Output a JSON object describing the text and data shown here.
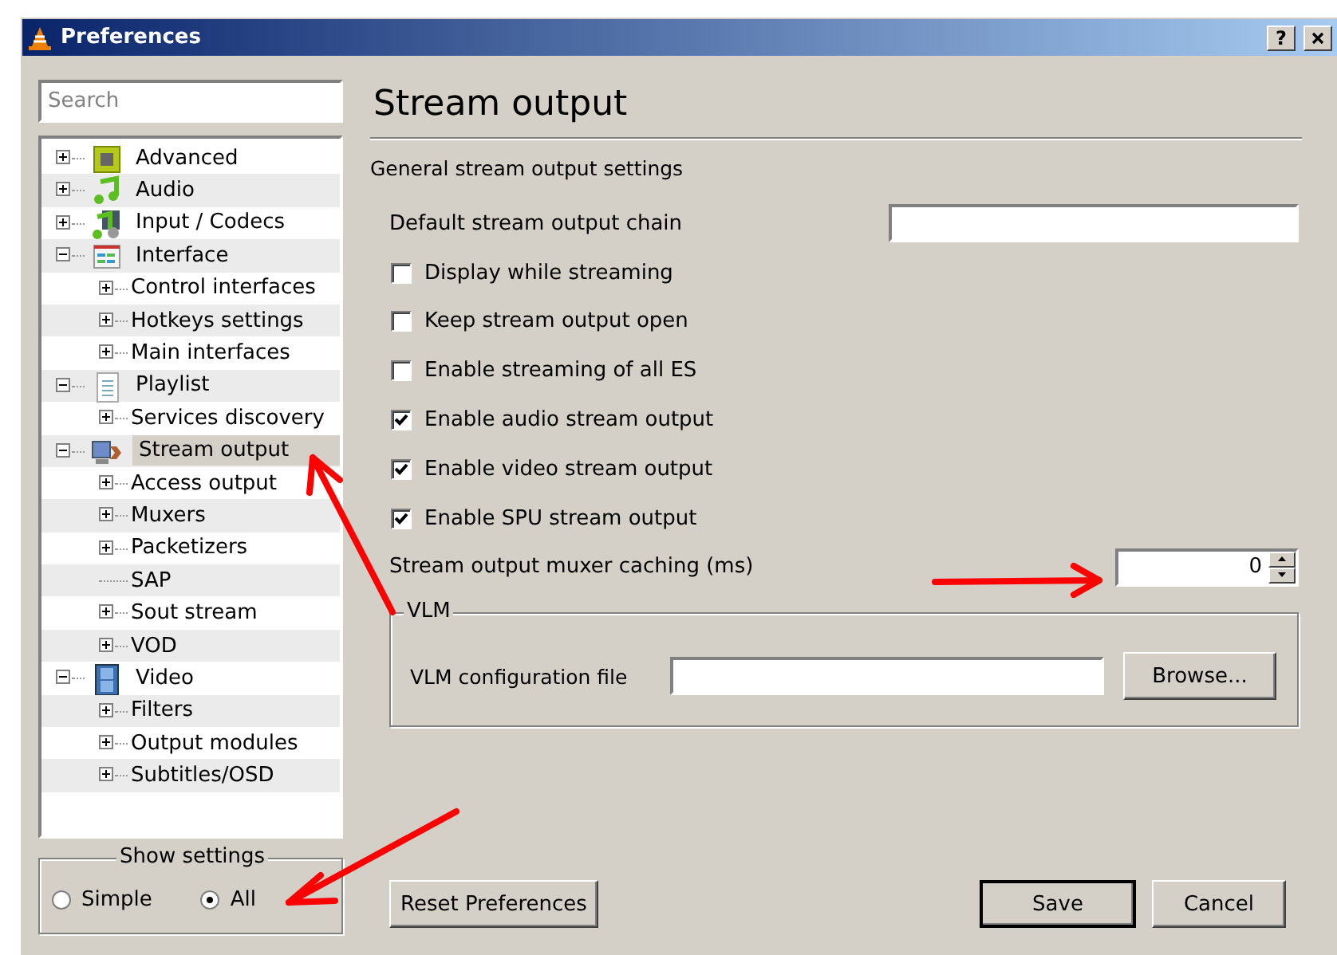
{
  "window": {
    "title": "Preferences",
    "help": "?"
  },
  "search": {
    "placeholder": "Search"
  },
  "tree": [
    {
      "label": "Advanced",
      "kind": "branch",
      "expanded": false,
      "selected": false
    },
    {
      "label": "Audio",
      "kind": "branch",
      "expanded": false,
      "selected": false
    },
    {
      "label": "Input / Codecs",
      "kind": "branch",
      "expanded": false,
      "selected": false
    },
    {
      "label": "Interface",
      "kind": "branch",
      "expanded": true,
      "selected": false,
      "children": [
        {
          "label": "Control interfaces",
          "kind": "branch",
          "expanded": false,
          "selected": false
        },
        {
          "label": "Hotkeys settings",
          "kind": "branch",
          "expanded": false,
          "selected": false
        },
        {
          "label": "Main interfaces",
          "kind": "branch",
          "expanded": false,
          "selected": false
        }
      ]
    },
    {
      "label": "Playlist",
      "kind": "branch",
      "expanded": true,
      "selected": false,
      "children": [
        {
          "label": "Services discovery",
          "kind": "branch",
          "expanded": false,
          "selected": false
        }
      ]
    },
    {
      "label": "Stream output",
      "kind": "branch",
      "expanded": true,
      "selected": true,
      "children": [
        {
          "label": "Access output",
          "kind": "branch",
          "expanded": false,
          "selected": false
        },
        {
          "label": "Muxers",
          "kind": "branch",
          "expanded": false,
          "selected": false
        },
        {
          "label": "Packetizers",
          "kind": "branch",
          "expanded": false,
          "selected": false
        },
        {
          "label": "SAP",
          "kind": "leaf",
          "selected": false
        },
        {
          "label": "Sout stream",
          "kind": "branch",
          "expanded": false,
          "selected": false
        },
        {
          "label": "VOD",
          "kind": "branch",
          "expanded": false,
          "selected": false
        }
      ]
    },
    {
      "label": "Video",
      "kind": "branch",
      "expanded": true,
      "selected": false,
      "children": [
        {
          "label": "Filters",
          "kind": "branch",
          "expanded": false,
          "selected": false
        },
        {
          "label": "Output modules",
          "kind": "branch",
          "expanded": false,
          "selected": false
        },
        {
          "label": "Subtitles/OSD",
          "kind": "branch",
          "expanded": false,
          "selected": false
        }
      ]
    }
  ],
  "show_settings": {
    "title": "Show settings",
    "options": [
      {
        "label": "Simple",
        "selected": false
      },
      {
        "label": "All",
        "selected": true
      }
    ]
  },
  "panel": {
    "title": "Stream output",
    "subtitle": "General stream output settings",
    "settings": [
      {
        "kind": "text",
        "label": "Default stream output chain"
      },
      {
        "kind": "checkbox",
        "label": "Display while streaming",
        "checked": false
      },
      {
        "kind": "checkbox",
        "label": "Keep stream output open",
        "checked": false
      },
      {
        "kind": "checkbox",
        "label": "Enable streaming of all ES",
        "checked": false
      },
      {
        "kind": "checkbox",
        "label": "Enable audio stream output",
        "checked": true
      },
      {
        "kind": "checkbox",
        "label": "Enable video stream output",
        "checked": true
      },
      {
        "kind": "checkbox",
        "label": "Enable SPU stream output",
        "checked": true
      },
      {
        "kind": "spin",
        "label": "Stream output muxer caching (ms)",
        "value": "0"
      }
    ],
    "vlm": {
      "title": "VLM",
      "label": "VLM configuration file",
      "button": "Browse..."
    }
  },
  "buttons": [
    {
      "label": "Reset Preferences"
    },
    {
      "label": "Save"
    },
    {
      "label": "Cancel"
    }
  ]
}
